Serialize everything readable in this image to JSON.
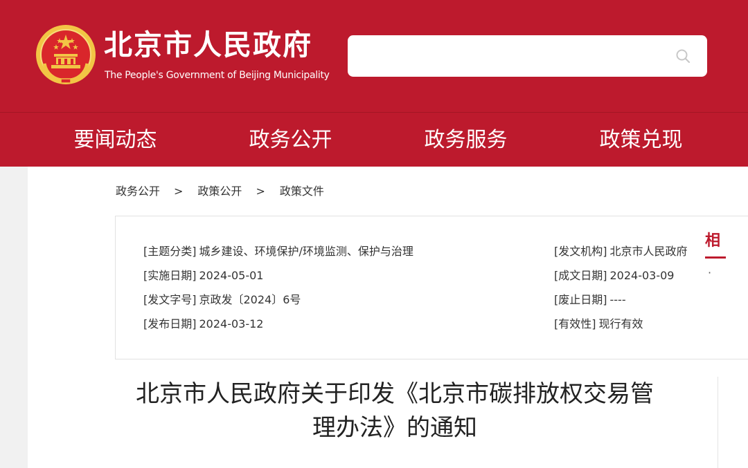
{
  "header": {
    "site_name": "北京市人民政府",
    "site_name_en": "The People's Government of Beijing Municipality",
    "search": {
      "placeholder": "",
      "value": ""
    }
  },
  "nav": {
    "items": [
      {
        "label": "要闻动态"
      },
      {
        "label": "政务公开"
      },
      {
        "label": "政务服务"
      },
      {
        "label": "政策兑现"
      }
    ]
  },
  "breadcrumb": {
    "items": [
      "政务公开",
      "政策公开",
      "政策文件"
    ],
    "separator": ">"
  },
  "info": {
    "topic": {
      "label": "[主题分类]",
      "value": "城乡建设、环境保护/环境监测、保护与治理"
    },
    "effective_date": {
      "label": "[实施日期]",
      "value": "2024-05-01"
    },
    "doc_number": {
      "label": "[发文字号]",
      "value": "京政发〔2024〕6号"
    },
    "publish_date": {
      "label": "[发布日期]",
      "value": "2024-03-12"
    },
    "issuer": {
      "label": "[发文机构]",
      "value": "北京市人民政府"
    },
    "written_date": {
      "label": "[成文日期]",
      "value": "2024-03-09"
    },
    "repeal_date": {
      "label": "[废止日期]",
      "value": "----"
    },
    "validity": {
      "label": "[有效性]",
      "value": "现行有效"
    }
  },
  "article": {
    "title_line1": "北京市人民政府关于印发《北京市碳排放权交易管",
    "title_line2": "理办法》的通知"
  },
  "sidebar": {
    "heading": "相",
    "bullet": "·"
  },
  "colors": {
    "brand_red": "#bd1a2d",
    "emblem_gold": "#f2c545"
  }
}
